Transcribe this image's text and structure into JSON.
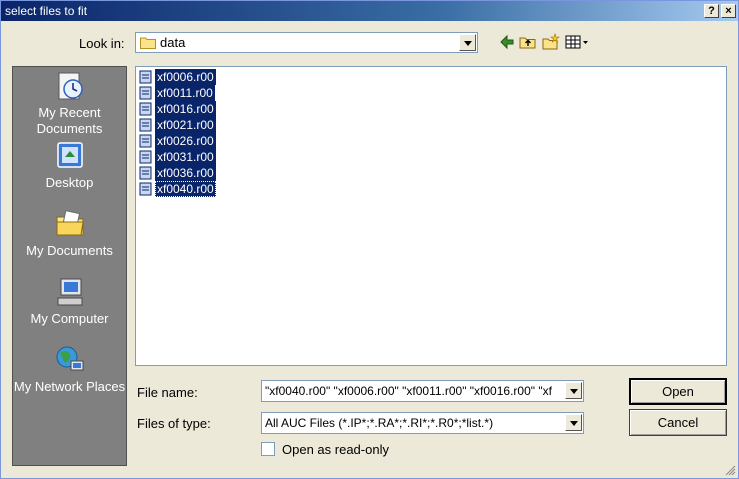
{
  "window": {
    "title": "select files to fit",
    "help_btn": "?",
    "close_btn": "×"
  },
  "lookin": {
    "label": "Look in:",
    "value": "data"
  },
  "places": [
    {
      "label": "My Recent Documents",
      "icon": "recent-documents-icon"
    },
    {
      "label": "Desktop",
      "icon": "desktop-icon"
    },
    {
      "label": "My Documents",
      "icon": "my-documents-icon"
    },
    {
      "label": "My Computer",
      "icon": "my-computer-icon"
    },
    {
      "label": "My Network Places",
      "icon": "network-places-icon"
    }
  ],
  "files": [
    "xf0006.r00",
    "xf0011.r00",
    "xf0016.r00",
    "xf0021.r00",
    "xf0026.r00",
    "xf0031.r00",
    "xf0036.r00",
    "xf0040.r00"
  ],
  "filename": {
    "label": "File name:",
    "value": "\"xf0040.r00\" \"xf0006.r00\" \"xf0011.r00\" \"xf0016.r00\" \"xf"
  },
  "filetype": {
    "label": "Files of type:",
    "value": "All AUC Files (*.IP*;*.RA*;*.RI*;*.R0*;*list.*)"
  },
  "buttons": {
    "open": "Open",
    "cancel": "Cancel"
  },
  "readonly": {
    "label": "Open as read-only",
    "checked": false
  },
  "colors": {
    "selection": "#0a246a",
    "title_bar": "#0a246a",
    "places_bar": "#808080"
  }
}
